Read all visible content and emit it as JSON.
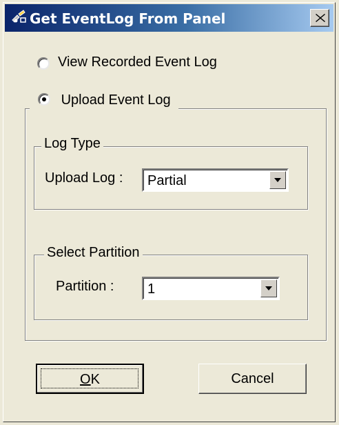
{
  "window": {
    "title": "Get EventLog From Panel",
    "title_icon": "app-icon",
    "close_icon": "close-icon"
  },
  "options": {
    "view_recorded": {
      "label": "View Recorded Event Log",
      "selected": false
    },
    "upload": {
      "label": "Upload Event Log",
      "selected": true
    }
  },
  "log_type_group": {
    "title": "Log Type",
    "field_label": "Upload Log :",
    "selected_value": "Partial"
  },
  "partition_group": {
    "title": "Select Partition",
    "field_label": "Partition :",
    "selected_value": "1"
  },
  "buttons": {
    "ok_mnemonic": "O",
    "ok_rest": "K",
    "cancel": "Cancel"
  },
  "colors": {
    "face": "#ece9d8",
    "title_start": "#0a246a",
    "title_end": "#a6caf0"
  }
}
